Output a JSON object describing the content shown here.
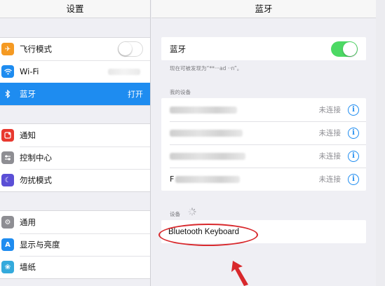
{
  "master": {
    "title": "设置",
    "groups": [
      [
        {
          "label": "飞行模式",
          "icon": "airplane-icon",
          "color": "#f59a23",
          "accessory": "toggle-off"
        },
        {
          "label": "Wi-Fi",
          "icon": "wifi-icon",
          "color": "#1e8cf0",
          "accessory": "blurred"
        },
        {
          "label": "蓝牙",
          "icon": "bluetooth-icon",
          "color": "#1e8cf0",
          "accessory": "value",
          "value": "打开",
          "selected": true
        }
      ],
      [
        {
          "label": "通知",
          "icon": "notifications-icon",
          "color": "#e8392f"
        },
        {
          "label": "控制中心",
          "icon": "control-center-icon",
          "color": "#8e8e93"
        },
        {
          "label": "勿扰模式",
          "icon": "do-not-disturb-icon",
          "color": "#5b4fd6"
        }
      ],
      [
        {
          "label": "通用",
          "icon": "gear-icon",
          "color": "#8e8e93"
        },
        {
          "label": "显示与亮度",
          "icon": "display-icon",
          "color": "#1e8cf0"
        },
        {
          "label": "墙纸",
          "icon": "wallpaper-icon",
          "color": "#34aadc"
        }
      ]
    ]
  },
  "detail": {
    "title": "蓝牙",
    "bluetooth_label": "蓝牙",
    "bluetooth_on": true,
    "discoverable_caption": "现在可被发现为“**···ad ··n”。",
    "my_devices_header": "我的设备",
    "my_devices": [
      {
        "status": "未连接"
      },
      {
        "status": "未连接"
      },
      {
        "status": "未连接"
      },
      {
        "status": "未连接",
        "visible_prefix": "F"
      }
    ],
    "devices_header": "设备",
    "found_device": "Bluetooth Keyboard"
  },
  "colors": {
    "accent": "#1e8cf0",
    "toggle_on": "#4cd964",
    "annotation": "#d8282c"
  }
}
